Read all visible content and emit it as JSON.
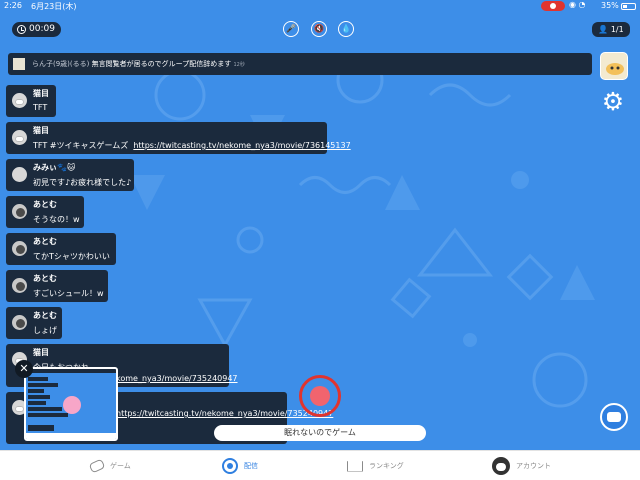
{
  "status_bar": {
    "time": "2:26",
    "date": "6月23日(木)",
    "battery": "35%"
  },
  "timer": "00:09",
  "viewers": "1/1",
  "banner": {
    "user": "らん子",
    "user_tag": "(9歳)(るる)",
    "message": "無言閲覧者が居るのでグループ配信辞めます",
    "time": "12秒"
  },
  "comments": [
    {
      "name": "猫目",
      "text": "TFT",
      "link": ""
    },
    {
      "name": "猫目",
      "text": "TFT #ツイキャスゲームズ",
      "link": "https://twitcasting.tv/nekome_nya3/movie/736145137"
    },
    {
      "name": "みみぃ🐾🐱",
      "text": "初見です♪お疲れ様でした♪",
      "link": ""
    },
    {
      "name": "あとむ",
      "text": "そうなの！w",
      "link": ""
    },
    {
      "name": "あとむ",
      "text": "てかTシャツかわいい",
      "link": ""
    },
    {
      "name": "あとむ",
      "text": "すごいシュール！w",
      "link": ""
    },
    {
      "name": "あとむ",
      "text": "しょげ",
      "link": ""
    },
    {
      "name": "猫目",
      "text": "今日もおつかれ",
      "link": "kome_nya3/movie/735240947"
    },
    {
      "name": "",
      "text": "",
      "link": "https://twitcasting.tv/nekome_nya3/movie/735240947"
    }
  ],
  "stream_title": "眠れないのでゲーム",
  "tabs": [
    {
      "label": "ゲーム",
      "icon": "gamepad-icon",
      "active": false
    },
    {
      "label": "配信",
      "icon": "broadcast-icon",
      "active": true
    },
    {
      "label": "ランキング",
      "icon": "crown-icon",
      "active": false
    },
    {
      "label": "アカウント",
      "icon": "account-avatar-icon",
      "active": false
    }
  ],
  "colors": {
    "background": "#3d8ee8",
    "panel": "#1b2a3d",
    "accent": "#2f7fe0",
    "record": "#e0342f"
  }
}
